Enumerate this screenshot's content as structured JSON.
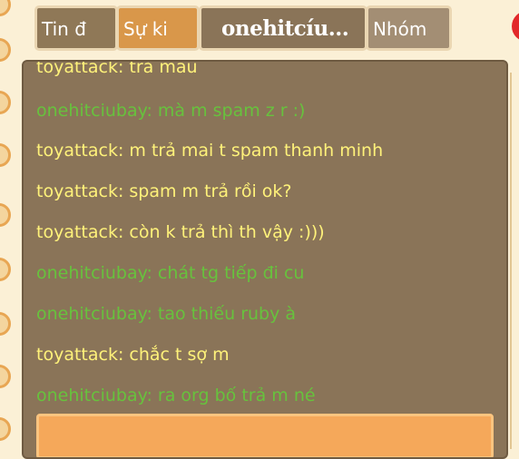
{
  "tabs": [
    {
      "label": "Tin đ"
    },
    {
      "label": "Sự ki"
    },
    {
      "label": "onehitcíu..."
    },
    {
      "label": "Nhóm"
    }
  ],
  "colors": {
    "other_user_text": "#fff27a",
    "self_user_text": "#67c23d",
    "panel_bg": "#8a7458",
    "input_bg": "#f5a85a"
  },
  "messages": [
    {
      "text": "toyattack: trả mau",
      "sender": "other"
    },
    {
      "text": "onehitciubay: mà m spam z r :)",
      "sender": "self"
    },
    {
      "text": "toyattack: m trả mai t spam thanh minh",
      "sender": "other"
    },
    {
      "text": "toyattack: spam m trả rồi ok?",
      "sender": "other"
    },
    {
      "text": "toyattack: còn k trả thì th vậy :)))",
      "sender": "other"
    },
    {
      "text": "onehitciubay: chát tg tiếp đi cu",
      "sender": "self"
    },
    {
      "text": "onehitciubay: tao thiếu ruby à",
      "sender": "self"
    },
    {
      "text": "toyattack: chắc t sợ m",
      "sender": "other"
    },
    {
      "text": "onehitciubay: ra org bố trả m né",
      "sender": "self"
    }
  ],
  "input": {
    "value": ""
  }
}
